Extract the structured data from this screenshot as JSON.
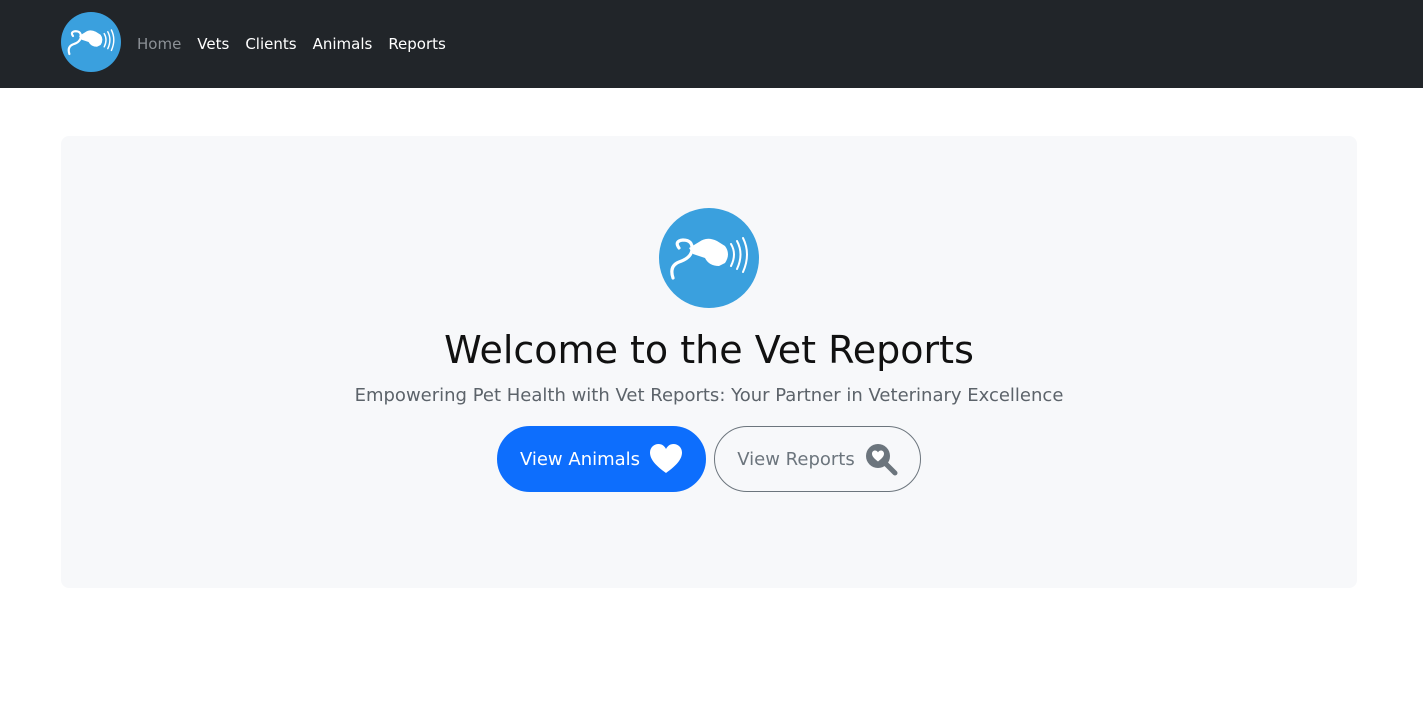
{
  "navbar": {
    "logo_icon": "ultrasound-probe-icon",
    "links": [
      {
        "label": "Home",
        "active": true
      },
      {
        "label": "Vets",
        "active": false
      },
      {
        "label": "Clients",
        "active": false
      },
      {
        "label": "Animals",
        "active": false
      },
      {
        "label": "Reports",
        "active": false
      }
    ]
  },
  "hero": {
    "logo_icon": "ultrasound-probe-icon",
    "title": "Welcome to the Vet Reports",
    "subtitle": "Empowering Pet Health with Vet Reports: Your Partner in Veterinary Excellence",
    "buttons": {
      "view_animals": {
        "label": "View Animals",
        "icon": "heart-icon"
      },
      "view_reports": {
        "label": "View Reports",
        "icon": "magnifier-heart-icon"
      }
    }
  },
  "colors": {
    "navbar_bg": "#212529",
    "brand_blue": "#3aa0de",
    "primary": "#0d6efd",
    "secondary": "#6c757d",
    "hero_bg": "#f7f8fa"
  }
}
